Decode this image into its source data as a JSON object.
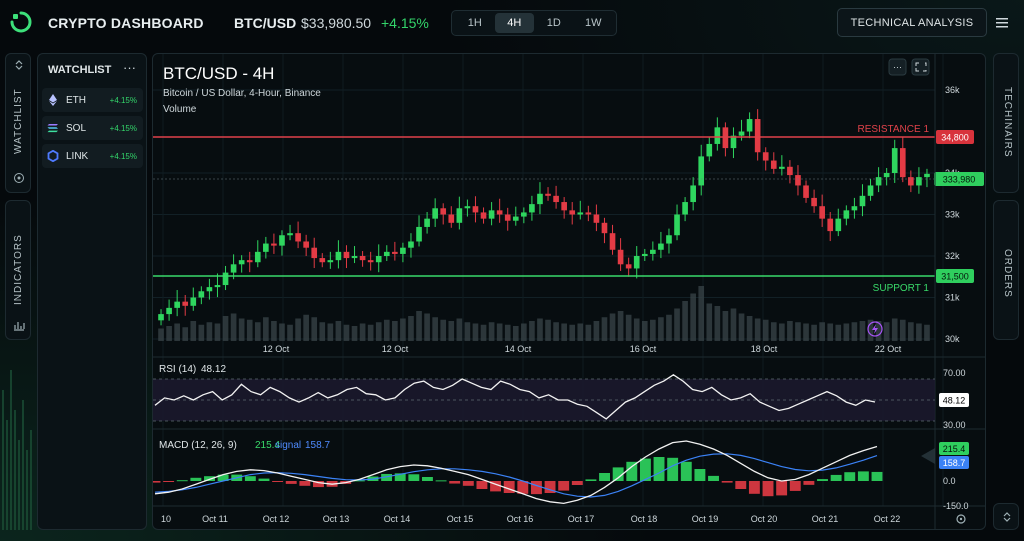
{
  "header": {
    "app_title": "CRYPTO DASHBOARD",
    "pair": "BTC/USD",
    "price": "$33,980.50",
    "change": "+4.15%",
    "timeframes": [
      "1H",
      "4H",
      "1D",
      "1W"
    ],
    "active_timeframe": "4H",
    "technical_analysis_label": "TECHNICAL ANALYSIS"
  },
  "rails": {
    "watchlist_label": "WATCHLIST",
    "indicators_label": "INDICATORS",
    "technicals_label": "TECHINAIRS",
    "orders_label": "ORDERS"
  },
  "watchlist": {
    "title": "WATCHLIST",
    "items": [
      {
        "symbol": "ETH",
        "change": "+4.15%"
      },
      {
        "symbol": "SOL",
        "change": "+4.15%"
      },
      {
        "symbol": "LINK",
        "change": "+4.15%"
      }
    ]
  },
  "chart": {
    "title": "BTC/USD - 4H",
    "subtitle": "Bitcoin / US Dollar, 4-Hour, Binance",
    "volume_label": "Volume",
    "resistance_label": "RESISTANCE 1",
    "support_label": "SUPPORT 1",
    "resistance_badge": "34,800",
    "support_badge": "31,500",
    "price_badge": "333,980",
    "y_ticks": [
      "36k",
      "34k",
      "33k",
      "32k",
      "31k",
      "30k"
    ],
    "y_tick_values": [
      36000,
      34000,
      33000,
      32000,
      31000,
      30000
    ],
    "top_x_ticks": [
      "12 Oct",
      "12 Oct",
      "14 Oct",
      "16 Oct",
      "18 Oct",
      "22 Oct"
    ],
    "rsi_label": "RSI (14)",
    "rsi_value": "48.12",
    "rsi_ticks": [
      "70.00",
      "30.00"
    ],
    "macd_label": "MACD (12, 26, 9)",
    "macd_value": "215.4",
    "signal_label": "signal",
    "signal_value": "158.7",
    "macd_badge": "215.4",
    "signal_badge": "158.7",
    "macd_ticks": [
      "0.0",
      "-150.0"
    ],
    "bottom_x_ticks": [
      "10",
      "Oct 11",
      "Oct 12",
      "Oct 13",
      "Oct 14",
      "Oct 15",
      "Oct 16",
      "Oct 17",
      "Oct 18",
      "Oct 19",
      "Oct 20",
      "Oct 21",
      "Oct 22"
    ]
  },
  "chart_data": {
    "type": "candlestick",
    "title": "BTC/USD - 4H",
    "ylim": [
      30000,
      36500
    ],
    "resistance": 34800,
    "support": 31500,
    "current_price": 33980,
    "candles_close": [
      30600,
      30750,
      30900,
      30800,
      31000,
      31150,
      31250,
      31300,
      31600,
      31800,
      31900,
      31850,
      32100,
      32300,
      32250,
      32500,
      32550,
      32350,
      32200,
      31950,
      31850,
      31900,
      32100,
      31950,
      32000,
      31900,
      31850,
      32000,
      32100,
      32050,
      32200,
      32350,
      32700,
      32900,
      33150,
      33000,
      32800,
      33150,
      33200,
      33050,
      32900,
      33100,
      33000,
      32850,
      32950,
      33050,
      33250,
      33500,
      33450,
      33300,
      33100,
      33000,
      33050,
      33000,
      32800,
      32550,
      32150,
      31800,
      31700,
      32000,
      32050,
      32150,
      32300,
      32500,
      33000,
      33300,
      33700,
      34400,
      34700,
      35100,
      34600,
      34900,
      35000,
      35300,
      34500,
      34300,
      34100,
      34150,
      33950,
      33700,
      33400,
      33200,
      32900,
      32600,
      32900,
      33100,
      33200,
      33450,
      33700,
      33900,
      34000,
      34600,
      33900,
      33700,
      33900,
      33980
    ],
    "volume": [
      10,
      12,
      14,
      11,
      16,
      13,
      15,
      14,
      20,
      22,
      18,
      17,
      15,
      19,
      16,
      14,
      13,
      18,
      21,
      19,
      15,
      14,
      16,
      13,
      12,
      14,
      13,
      15,
      17,
      16,
      18,
      20,
      24,
      22,
      19,
      17,
      16,
      18,
      15,
      14,
      13,
      15,
      14,
      13,
      12,
      14,
      16,
      18,
      17,
      15,
      14,
      13,
      14,
      13,
      16,
      19,
      22,
      24,
      21,
      18,
      16,
      17,
      19,
      21,
      26,
      32,
      38,
      44,
      30,
      28,
      24,
      26,
      22,
      20,
      18,
      17,
      15,
      14,
      16,
      15,
      14,
      13,
      15,
      14,
      13,
      14,
      15,
      16,
      17,
      16,
      15,
      18,
      17,
      15,
      14,
      13
    ],
    "rsi": [
      45,
      52,
      50,
      54,
      50,
      55,
      58,
      50,
      55,
      65,
      58,
      55,
      62,
      58,
      52,
      48,
      52,
      57,
      52,
      55,
      60,
      62,
      56,
      55,
      50,
      52,
      60,
      66,
      68,
      62,
      60,
      64,
      70,
      66,
      62,
      60,
      68,
      65,
      60,
      58,
      52,
      55,
      50,
      50,
      46,
      44,
      38,
      32,
      40,
      48,
      52,
      58,
      64,
      68,
      74,
      68,
      60,
      58,
      62,
      55,
      50,
      52,
      56,
      48,
      44,
      40,
      42,
      46,
      50,
      54,
      58,
      54,
      48,
      45,
      50,
      48.12
    ],
    "macd": [
      -80,
      -70,
      -50,
      -20,
      10,
      40,
      60,
      70,
      65,
      50,
      30,
      10,
      -10,
      -20,
      -10,
      10,
      40,
      70,
      90,
      100,
      95,
      80,
      60,
      40,
      10,
      -20,
      -50,
      -80,
      -110,
      -130,
      -140,
      -120,
      -90,
      -40,
      20,
      90,
      150,
      200,
      240,
      250,
      230,
      200,
      160,
      110,
      60,
      20,
      0,
      10,
      40,
      80,
      120,
      160,
      190,
      215.4
    ],
    "signal": [
      -70,
      -65,
      -55,
      -40,
      -20,
      0,
      20,
      40,
      50,
      52,
      48,
      40,
      28,
      16,
      8,
      6,
      12,
      26,
      42,
      58,
      70,
      76,
      76,
      70,
      60,
      45,
      25,
      0,
      -28,
      -55,
      -80,
      -95,
      -100,
      -90,
      -65,
      -30,
      10,
      50,
      95,
      130,
      155,
      168,
      170,
      160,
      140,
      115,
      90,
      72,
      64,
      68,
      82,
      105,
      130,
      158.7
    ]
  }
}
